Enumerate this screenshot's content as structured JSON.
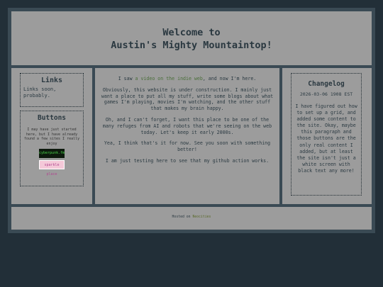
{
  "header": {
    "title_line1": "Welcome to",
    "title_line2": "Austin's Mighty Mountaintop!"
  },
  "links": {
    "title": "Links",
    "text": "Links soon, probably."
  },
  "buttons": {
    "title": "Buttons",
    "text": "I may have just started here, but I have already found a few sites I really enjoy",
    "badge_1": "cyberpunk.fm",
    "badge_2": "sparkle place"
  },
  "center": {
    "intro_before": "I saw ",
    "intro_link": "a video on the indie web",
    "intro_after": ", and now I'm here.",
    "p2": "Obviously, this website is under construction. I mainly just want a place to put all my stuff, write some blogs about what games I'm playing, movies I'm watching, and the other stuff that makes my brain happy.",
    "p3": "Oh, and I can't forget, I want this place to be one of the many refuges from AI and robots that we're seeing on the web today. Let's keep it early 2000s.",
    "p4": "Yea, I think that's it for now. See you soon with something better!",
    "p5": "I am just testing here to see that my github action works."
  },
  "changelog": {
    "title": "Changelog",
    "date": "2026-03-06 1908 EST",
    "entry": "I have figured out how to set up a grid, and added some content to the site. Okay, maybe this paragraph and those buttons are the only real content I added, but at least the site isn't just a white screen with black text any more!"
  },
  "footer": {
    "hosted_label": "Hosted on ",
    "host_link": "Neocities"
  },
  "colors": {
    "background": "#222f38",
    "frame": "#3a4a54",
    "panel": "#9c9c9c",
    "text": "#2b3a42",
    "link": "#4a6e3a"
  }
}
